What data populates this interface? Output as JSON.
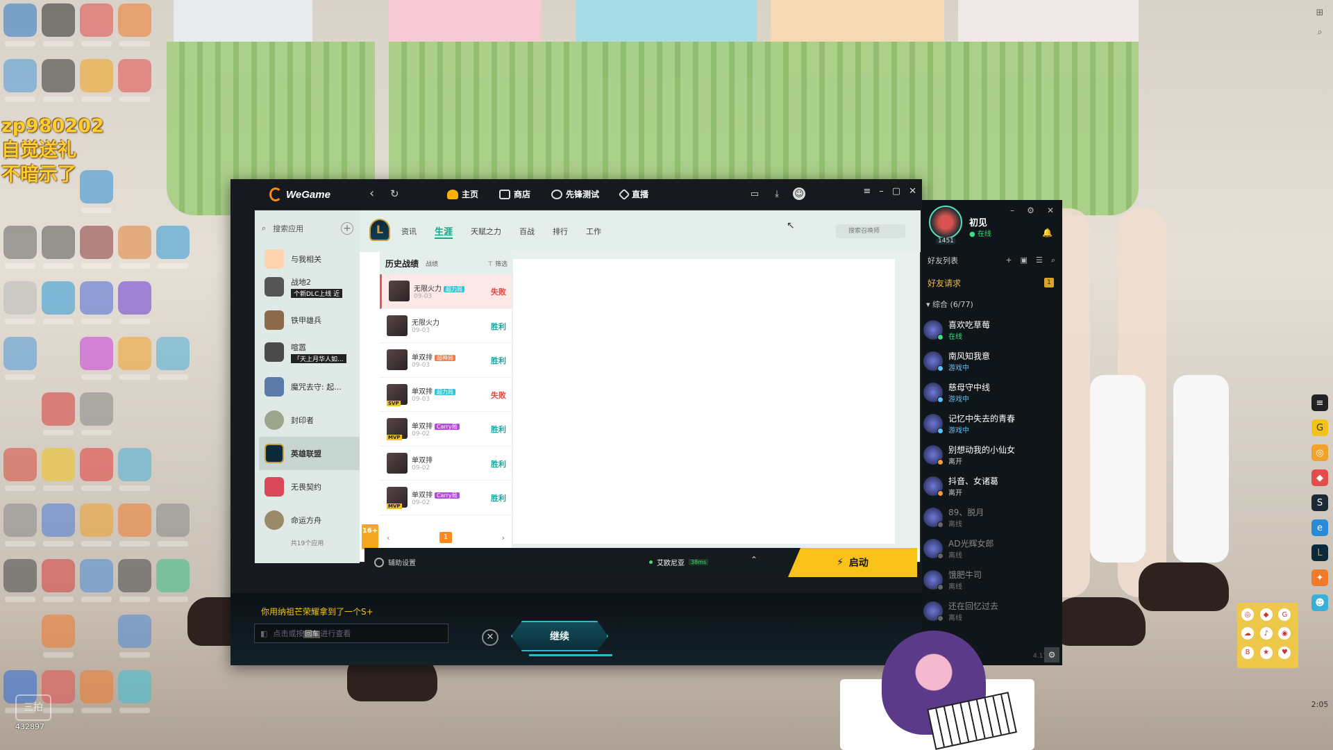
{
  "overlay": {
    "line1": "zp980202",
    "line2": "自觉送礼",
    "line3": "不暗示了",
    "viewer_count": "432897",
    "viewer_logo": "三拍"
  },
  "wegame": {
    "logo": "WeGame",
    "nav": [
      {
        "label": "主页",
        "icon": "home-icon"
      },
      {
        "label": "商店",
        "icon": "store-icon"
      },
      {
        "label": "先锋测试",
        "icon": "test-icon"
      },
      {
        "label": "直播",
        "icon": "live-icon"
      }
    ]
  },
  "apps": {
    "search_placeholder": "搜索应用",
    "count_text": "共19个应用",
    "items": [
      {
        "name": "与我相关",
        "sub": ""
      },
      {
        "name": "战地2",
        "sub": "个新DLC上线 近"
      },
      {
        "name": "铁甲雄兵",
        "sub": ""
      },
      {
        "name": "喧嚣",
        "sub": "「天上月华人如..."
      },
      {
        "name": "魔咒去守: 起...",
        "sub": ""
      },
      {
        "name": "封印者",
        "sub": ""
      },
      {
        "name": "英雄联盟",
        "sub": ""
      },
      {
        "name": "无畏契约",
        "sub": ""
      },
      {
        "name": "命运方舟",
        "sub": ""
      }
    ]
  },
  "lol": {
    "logo_letter": "L",
    "subnav": [
      "资讯",
      "生涯",
      "天赋之力",
      "百战",
      "排行",
      "工作"
    ],
    "search_placeholder": "搜索召唤师",
    "history_title": "历史战绩",
    "history_sub": "战绩",
    "filter": "筛选",
    "age_rating": "16+",
    "matches": [
      {
        "mode": "无限火力",
        "tag": "超力局",
        "tag_color": "#37c2d6",
        "date": "09-03",
        "result": "失败",
        "mvp": ""
      },
      {
        "mode": "无限火力",
        "tag": "",
        "tag_color": "",
        "date": "09-03",
        "result": "胜利",
        "mvp": ""
      },
      {
        "mode": "单双排",
        "tag": "超神局",
        "tag_color": "#f07a4a",
        "date": "09-03",
        "result": "胜利",
        "mvp": ""
      },
      {
        "mode": "单双排",
        "tag": "超力局",
        "tag_color": "#37c2d6",
        "date": "09-03",
        "result": "失败",
        "mvp": "SVP"
      },
      {
        "mode": "单双排",
        "tag": "Carry局",
        "tag_color": "#b24bd9",
        "date": "09-02",
        "result": "胜利",
        "mvp": "MVP"
      },
      {
        "mode": "单双排",
        "tag": "",
        "tag_color": "",
        "date": "09-02",
        "result": "胜利",
        "mvp": ""
      },
      {
        "mode": "单双排",
        "tag": "Carry局",
        "tag_color": "#b24bd9",
        "date": "09-02",
        "result": "胜利",
        "mvp": "MVP"
      }
    ],
    "page": "1",
    "assist_label": "辅助设置",
    "server": "艾欧尼亚",
    "ping": "38ms",
    "launch_label": "启动"
  },
  "post_game": {
    "achievement": "你用纳祖芒荣耀拿到了一个S+",
    "chat_placeholder_a": "点击或按",
    "chat_enter": "回车",
    "chat_placeholder_b": "进行查看",
    "continue_label": "继续"
  },
  "friends": {
    "me_name": "初见",
    "me_status": "在线",
    "me_level": "1451",
    "list_title": "好友列表",
    "requests_label": "好友请求",
    "requests_count": "1",
    "group_label": "综合 (6/77)",
    "version": "4.17",
    "items": [
      {
        "name": "喜欢吃草莓",
        "status": "在线",
        "kind": "online"
      },
      {
        "name": "南风知我意",
        "status": "游戏中",
        "kind": "gaming"
      },
      {
        "name": "慈母守中线",
        "status": "游戏中",
        "kind": "gaming"
      },
      {
        "name": "记忆中失去的青春",
        "status": "游戏中",
        "kind": "gaming"
      },
      {
        "name": "别想动我的小仙女",
        "status": "离开",
        "kind": "away"
      },
      {
        "name": "抖音、女诸葛",
        "status": "离开",
        "kind": "away"
      },
      {
        "name": "89、脱月",
        "status": "离线",
        "kind": "offline"
      },
      {
        "name": "AD光辉女郎",
        "status": "离线",
        "kind": "offline"
      },
      {
        "name": "饿肥牛司",
        "status": "离线",
        "kind": "offline"
      },
      {
        "name": "还在回忆过去",
        "status": "离线",
        "kind": "offline"
      }
    ]
  },
  "taskbar": {
    "time": "2:05"
  },
  "colors": {
    "accent_green": "#18a886",
    "win": "#1aa6a0",
    "lose": "#e0473e",
    "launch": "#f8c21b",
    "overlay_text": "#ffcc33"
  }
}
